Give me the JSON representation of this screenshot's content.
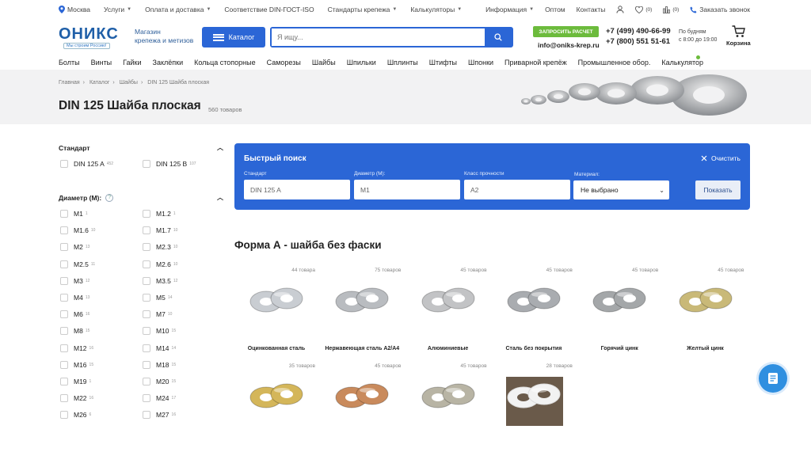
{
  "topbar": {
    "city": "Москва",
    "links": [
      "Услуги",
      "Оплата и доставка",
      "Соответствие DIN-ГОСТ-ISO",
      "Стандарты крепежа",
      "Калькуляторы"
    ],
    "info": "Информация",
    "wholesale": "Оптом",
    "contacts": "Контакты",
    "favorites_count": "(0)",
    "compare_count": "(0)",
    "callback": "Заказать звонок"
  },
  "header": {
    "logo_text": "ОНИКС",
    "logo_tagline": "Мы строим Россию!",
    "shop_line1": "Магазин",
    "shop_line2": "крепежа и метизов",
    "catalog_label": "Каталог",
    "search_placeholder": "Я ищу...",
    "request_button": "ЗАПРОСИТЬ РАСЧЕТ",
    "email": "info@oniks-krep.ru",
    "phone1": "+7 (499) 490-66-99",
    "phone2": "+7 (800) 551 51-61",
    "hours_line1": "По будням",
    "hours_line2": "с 8:00 до 19:00",
    "cart_label": "Корзина"
  },
  "nav": [
    "Болты",
    "Винты",
    "Гайки",
    "Заклёпки",
    "Кольца стопорные",
    "Саморезы",
    "Шайбы",
    "Шпильки",
    "Шплинты",
    "Штифты",
    "Шпонки",
    "Приварной крепёж",
    "Промышленное обор.",
    "Калькулятор"
  ],
  "breadcrumbs": [
    "Главная",
    "Каталог",
    "Шайбы",
    "DIN 125 Шайба плоская"
  ],
  "page": {
    "title": "DIN 125 Шайба плоская",
    "count": "560 товаров"
  },
  "filters": {
    "standard_title": "Стандарт",
    "standards": [
      {
        "label": "DIN 125 A",
        "count": "452"
      },
      {
        "label": "DIN 125 B",
        "count": "107"
      }
    ],
    "diameter_title": "Диаметр (М):",
    "diameters": [
      {
        "label": "M1",
        "count": "1"
      },
      {
        "label": "M1.2",
        "count": "1"
      },
      {
        "label": "M1.6",
        "count": "10"
      },
      {
        "label": "M1.7",
        "count": "10"
      },
      {
        "label": "M2",
        "count": "13"
      },
      {
        "label": "M2.3",
        "count": "10"
      },
      {
        "label": "M2.5",
        "count": "11"
      },
      {
        "label": "M2.6",
        "count": "10"
      },
      {
        "label": "M3",
        "count": "12"
      },
      {
        "label": "M3.5",
        "count": "12"
      },
      {
        "label": "M4",
        "count": "13"
      },
      {
        "label": "M5",
        "count": "14"
      },
      {
        "label": "M6",
        "count": "16"
      },
      {
        "label": "M7",
        "count": "10"
      },
      {
        "label": "M8",
        "count": "15"
      },
      {
        "label": "M10",
        "count": "15"
      },
      {
        "label": "M12",
        "count": "16"
      },
      {
        "label": "M14",
        "count": "14"
      },
      {
        "label": "M16",
        "count": "15"
      },
      {
        "label": "M18",
        "count": "15"
      },
      {
        "label": "M19",
        "count": "1"
      },
      {
        "label": "M20",
        "count": "15"
      },
      {
        "label": "M22",
        "count": "16"
      },
      {
        "label": "M24",
        "count": "17"
      },
      {
        "label": "M26",
        "count": "6"
      },
      {
        "label": "M27",
        "count": "16"
      }
    ]
  },
  "quick_search": {
    "title": "Быстрый поиск",
    "clear": "Очистить",
    "fields": [
      {
        "label": "Стандарт",
        "value": "DIN 125 A"
      },
      {
        "label": "Диаметр (М):",
        "value": "M1"
      },
      {
        "label": "Класс прочности",
        "value": "A2"
      }
    ],
    "material_label": "Материал:",
    "material_value": "Не выбрано",
    "show_button": "Показать"
  },
  "section_title": "Форма А - шайба без фаски",
  "products": [
    {
      "name": "Оцинкованная сталь",
      "count": "44 товара",
      "color": "#c9cdd2"
    },
    {
      "name": "Нержавеющая сталь А2/А4",
      "count": "75 товаров",
      "color": "#b9bcc0"
    },
    {
      "name": "Алюминиевые",
      "count": "45 товаров",
      "color": "#c2c3c5"
    },
    {
      "name": "Сталь без покрытия",
      "count": "45 товаров",
      "color": "#a9acb0"
    },
    {
      "name": "Горячий цинк",
      "count": "45 товаров",
      "color": "#a4a7a9"
    },
    {
      "name": "Желтый цинк",
      "count": "45 товаров",
      "color": "#c9b978"
    },
    {
      "name": "",
      "count": "35 товаров",
      "color": "#d4b65a"
    },
    {
      "name": "",
      "count": "45 товаров",
      "color": "#c98a5c"
    },
    {
      "name": "",
      "count": "45 товаров",
      "color": "#b8b4a4"
    },
    {
      "name": "",
      "count": "28 товаров",
      "color": "#f2f2f2"
    }
  ]
}
